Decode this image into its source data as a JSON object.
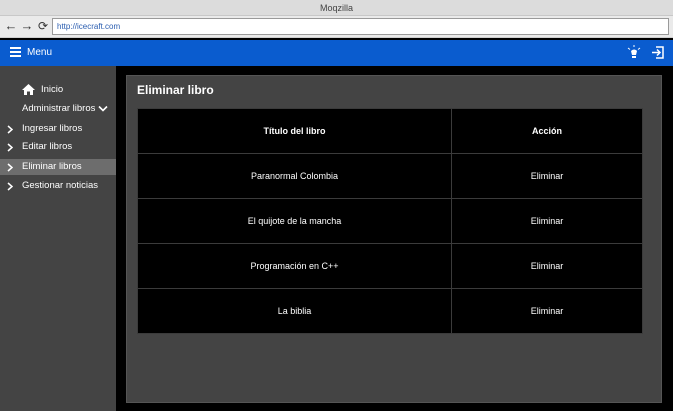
{
  "window": {
    "title": "Moqzilla"
  },
  "browser": {
    "url": "http://icecraft.com"
  },
  "header": {
    "menu_label": "Menu"
  },
  "sidebar": {
    "home": "Inicio",
    "admin": "Administrar libros",
    "items": [
      {
        "label": "Ingresar libros"
      },
      {
        "label": "Editar libros"
      },
      {
        "label": "Eliminar libros"
      },
      {
        "label": "Gestionar noticias"
      }
    ]
  },
  "main": {
    "title": "Eliminar libro",
    "table": {
      "headers": [
        "Título del libro",
        "Acción"
      ],
      "rows": [
        {
          "title": "Paranormal Colombia",
          "action": "Eliminar"
        },
        {
          "title": "El quijote de la mancha",
          "action": "Eliminar"
        },
        {
          "title": "Programación en C++",
          "action": "Eliminar"
        },
        {
          "title": "La biblia",
          "action": "Eliminar"
        }
      ]
    }
  },
  "colors": {
    "header_blue": "#0a5ccf",
    "sidebar_bg": "#444444",
    "sidebar_active": "#6d6d6d"
  }
}
